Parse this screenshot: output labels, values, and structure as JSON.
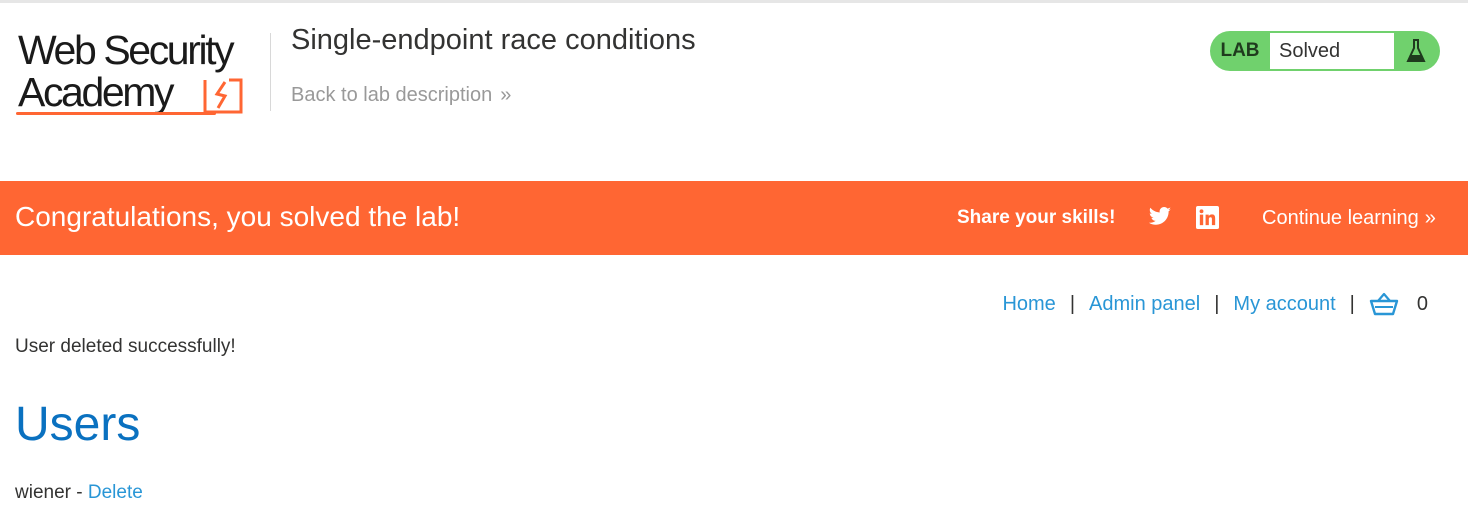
{
  "header": {
    "logo_line1": "Web Security",
    "logo_line2": "Academy",
    "lab_title": "Single-endpoint race conditions",
    "back_link": "Back to lab description",
    "back_chevron": "»",
    "lab_status": {
      "tag": "LAB",
      "state": "Solved",
      "accent": "#70d16d"
    }
  },
  "banner": {
    "message": "Congratulations, you solved the lab!",
    "share_label": "Share your skills!",
    "continue_label": "Continue learning",
    "continue_chevron": "»",
    "background": "#ff6633"
  },
  "nav": {
    "items": [
      {
        "label": "Home"
      },
      {
        "label": "Admin panel"
      },
      {
        "label": "My account"
      }
    ],
    "separator": "|",
    "cart_count": "0"
  },
  "main": {
    "notice": "User deleted successfully!",
    "heading": "Users",
    "users": [
      {
        "name": "wiener",
        "separator": " - ",
        "action": "Delete"
      }
    ]
  }
}
